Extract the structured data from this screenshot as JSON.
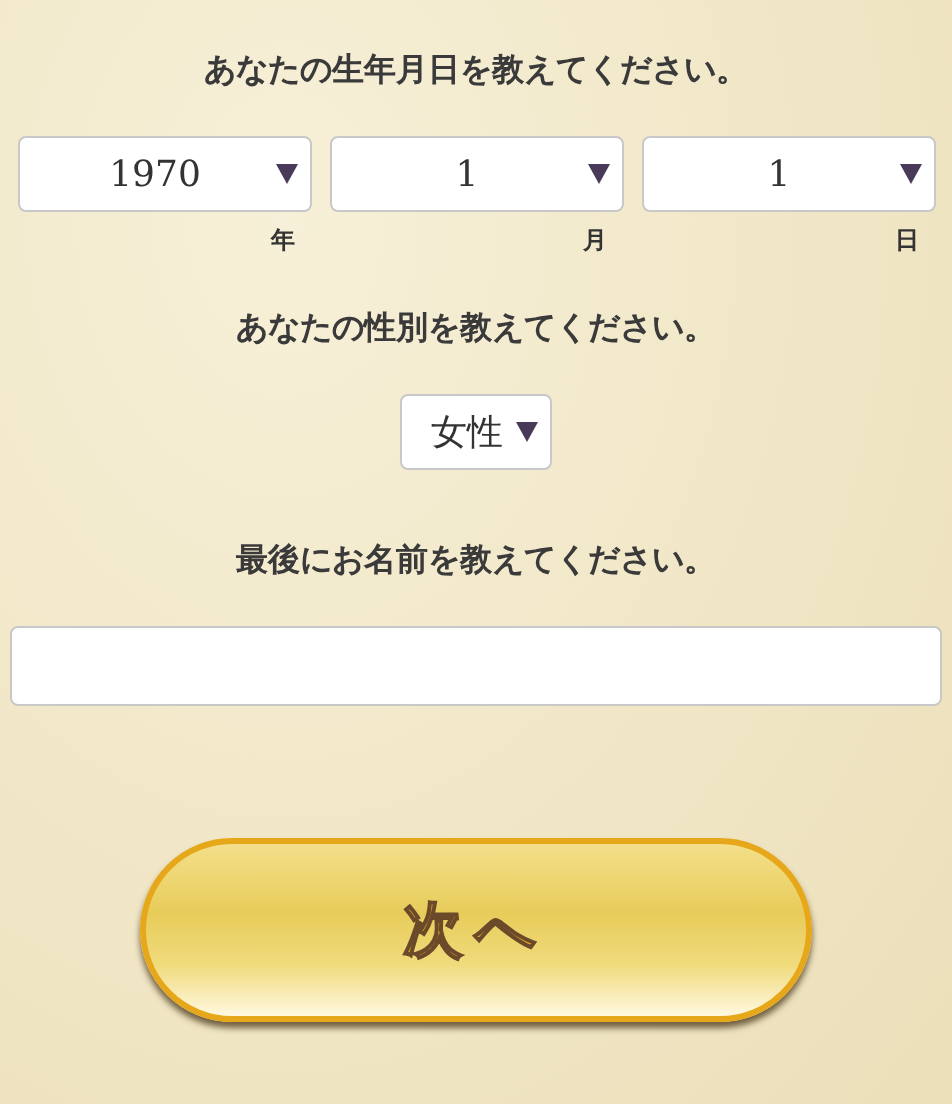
{
  "birth_question": "あなたの生年月日を教えてください。",
  "birth_selects": [
    {
      "value": "1970",
      "unit": "年"
    },
    {
      "value": "1",
      "unit": "月"
    },
    {
      "value": "1",
      "unit": "日"
    }
  ],
  "gender_question": "あなたの性別を教えてください。",
  "gender_select": {
    "value": "女性"
  },
  "name_question": "最後にお名前を教えてください。",
  "next_button": {
    "label": "次へ"
  }
}
